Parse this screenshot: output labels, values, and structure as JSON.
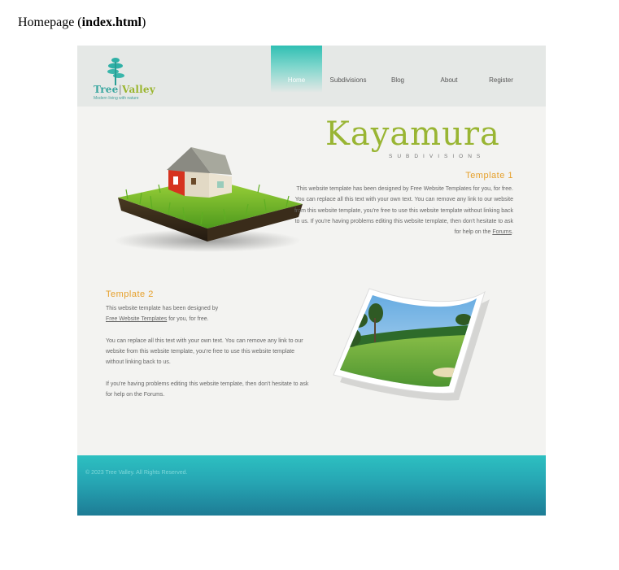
{
  "caption": {
    "prefix": "Homepage (",
    "file": "index.html",
    "suffix": ")"
  },
  "logo": {
    "name_left": "Tree",
    "name_right": "Valley",
    "tagline": "Modern living with nature"
  },
  "nav": {
    "items": [
      "Home",
      "Subdivisions",
      "Blog",
      "About",
      "Register"
    ],
    "active": "Home"
  },
  "brand": {
    "title": "Kayamura",
    "subtitle": "SUBDIVISIONS"
  },
  "template1": {
    "title": "Template 1",
    "body": "This website template has been designed by Free Website Templates for you, for free. You can replace all this text with your own text. You can remove any link to our website from this website template, you're free to use this website template without linking back to us. If you're having problems editing this website template, then don't hesitate to ask for help on the",
    "link": "Forums",
    "end": "."
  },
  "template2": {
    "title": "Template 2",
    "p1_text": "This website template has been designed by",
    "p1_link": "Free Website Templates",
    "p1_end": "for you, for free.",
    "p2": "You can replace all this text with your own text. You can remove any link to our website from this website template, you're free to use this website template without linking back to us.",
    "p3": "If you're having problems editing this website template, then don't hesitate to ask for help on the Forums."
  },
  "footer": {
    "text": "© 2023 Tree Valley. All Rights Reserved."
  },
  "colors": {
    "accent": "#2fbfb3",
    "brand": "#99b533",
    "heading": "#e6a02b",
    "footer": "#1d7c95"
  }
}
